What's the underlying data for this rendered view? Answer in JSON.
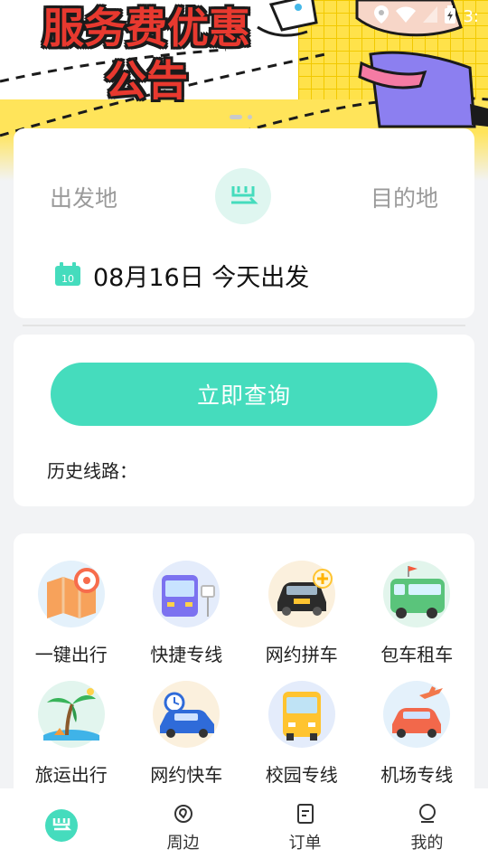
{
  "banner": {
    "title_line1": "服务费优惠",
    "title_line2": "公告",
    "status_time": "3:"
  },
  "route": {
    "from_placeholder": "出发地",
    "to_placeholder": "目的地",
    "calendar_day": "10",
    "date_label": "08月16日 今天出发"
  },
  "query": {
    "button_label": "立即查询",
    "history_label": "历史线路："
  },
  "services": [
    {
      "label": "一键出行",
      "icon": "map-pin-icon"
    },
    {
      "label": "快捷专线",
      "icon": "bus-stop-icon"
    },
    {
      "label": "网约拼车",
      "icon": "carpool-icon"
    },
    {
      "label": "包车租车",
      "icon": "charter-bus-icon"
    },
    {
      "label": "旅运出行",
      "icon": "palm-tree-icon"
    },
    {
      "label": "网约快车",
      "icon": "express-car-icon"
    },
    {
      "label": "校园专线",
      "icon": "school-bus-icon"
    },
    {
      "label": "机场专线",
      "icon": "airport-car-icon"
    }
  ],
  "tabbar": {
    "tabs": [
      {
        "label": "",
        "icon": "home-logo-icon"
      },
      {
        "label": "周边",
        "icon": "nearby-icon"
      },
      {
        "label": "订单",
        "icon": "orders-icon"
      },
      {
        "label": "我的",
        "icon": "profile-icon"
      }
    ]
  },
  "colors": {
    "accent": "#45dcbd",
    "banner_title": "#e8392f",
    "banner_yellow": "#ffe45a"
  }
}
